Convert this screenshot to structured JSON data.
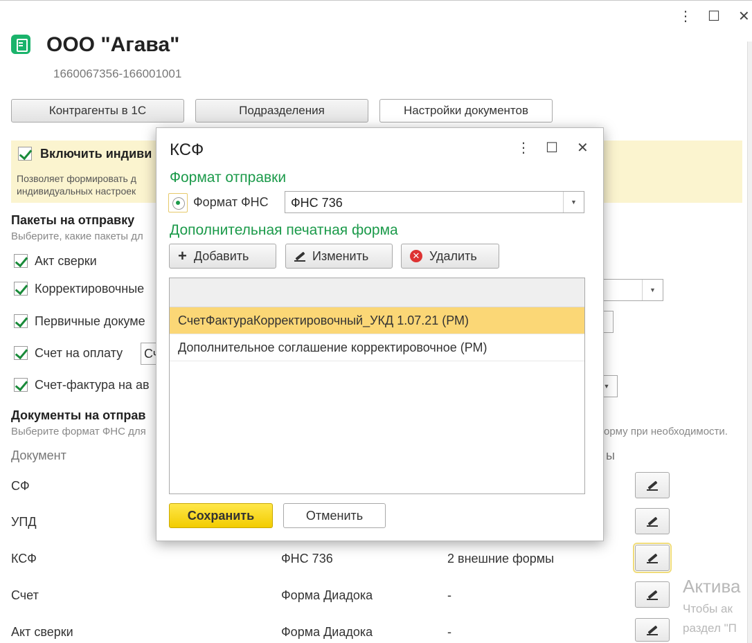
{
  "window": {
    "menu_icon": "⋮",
    "maximize_icon": "☐",
    "close_icon": "✕"
  },
  "org": {
    "name": "ООО \"Агава\"",
    "inn_kpp": "1660067356-166001001"
  },
  "top_buttons": {
    "contractors": "Контрагенты в 1С",
    "departments": "Подразделения",
    "doc_settings": "Настройки документов"
  },
  "individual": {
    "label": "Включить индиви",
    "desc_line1": "Позволяет формировать д",
    "desc_line2": "индивидуальных настроек"
  },
  "packages": {
    "title": "Пакеты на отправку",
    "hint": "Выберите, какие пакеты дл",
    "items": [
      {
        "label": "Акт сверки"
      },
      {
        "label": "Корректировочные"
      },
      {
        "label": "Первичные докуме"
      },
      {
        "label": "Счет на оплату",
        "field_value": "Сч"
      },
      {
        "label": "Счет-фактура на ав"
      }
    ]
  },
  "documents": {
    "title": "Документы на отправ",
    "hint_left": "Выберите формат ФНС для",
    "hint_right": "орму при необходимости.",
    "col_document": "Документ",
    "col_forms_tail": "ы",
    "rows": [
      {
        "doc": "СФ",
        "format": "",
        "forms": ""
      },
      {
        "doc": "УПД",
        "format": "",
        "forms": ""
      },
      {
        "doc": "КСФ",
        "format": "ФНС 736",
        "forms": "2 внешние формы"
      },
      {
        "doc": "Счет",
        "format": "Форма Диадока",
        "forms": "-"
      },
      {
        "doc": "Акт сверки",
        "format": "Форма Диадока",
        "forms": "-"
      }
    ]
  },
  "watermark": {
    "line1": "Актива",
    "line2": "Чтобы ак",
    "line3": "раздел \"П"
  },
  "modal": {
    "title": "КСФ",
    "menu_icon": "⋮",
    "maximize_icon": "☐",
    "close_icon": "✕",
    "section_format": "Формат отправки",
    "radio_label": "Формат ФНС",
    "format_value": "ФНС 736",
    "section_print": "Дополнительная печатная форма",
    "btn_add": "Добавить",
    "btn_edit": "Изменить",
    "btn_delete": "Удалить",
    "list_items": [
      {
        "label": "СчетФактураКорректировочный_УКД 1.07.21 (РМ)"
      },
      {
        "label": "Дополнительное соглашение корректировочное (РМ)"
      }
    ],
    "btn_save": "Сохранить",
    "btn_cancel": "Отменить"
  },
  "colors": {
    "accent_green": "#1b9a4a",
    "selected_row": "#fbd776",
    "save_yellow": "#f2cc00",
    "band_yellow": "#fbf4cf"
  }
}
